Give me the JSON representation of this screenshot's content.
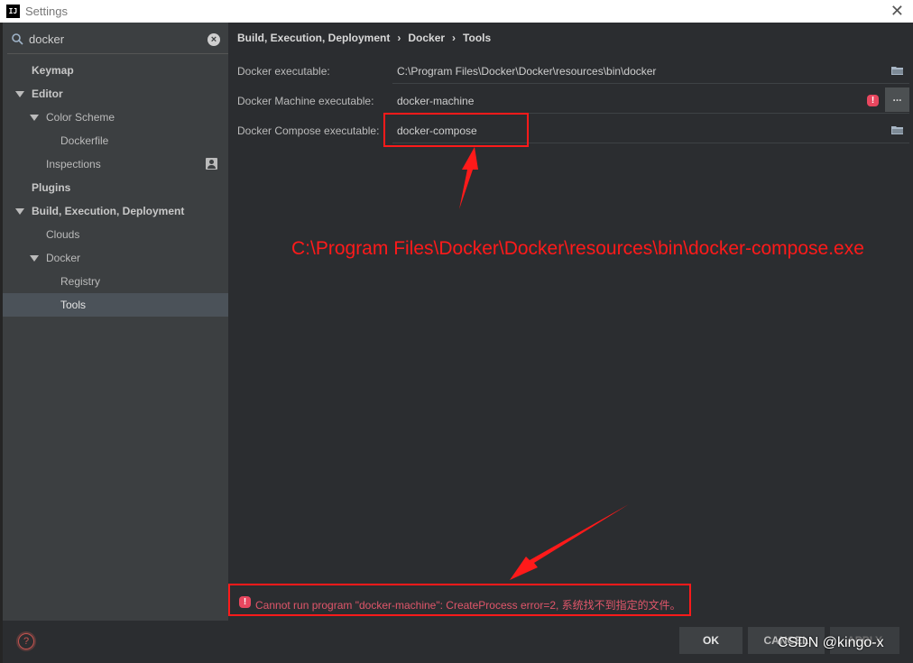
{
  "window": {
    "title": "Settings",
    "app_icon_text": "IJ"
  },
  "search": {
    "value": "docker",
    "placeholder": ""
  },
  "tree": [
    {
      "label": "Keymap"
    },
    {
      "label": "Editor"
    },
    {
      "label": "Color Scheme"
    },
    {
      "label": "Dockerfile"
    },
    {
      "label": "Inspections"
    },
    {
      "label": "Plugins"
    },
    {
      "label": "Build, Execution, Deployment"
    },
    {
      "label": "Clouds"
    },
    {
      "label": "Docker"
    },
    {
      "label": "Registry"
    },
    {
      "label": "Tools"
    }
  ],
  "breadcrumb": [
    "Build, Execution, Deployment",
    "Docker",
    "Tools"
  ],
  "breadcrumb_separator": "›",
  "fields": [
    {
      "label": "Docker executable:",
      "value": "C:\\Program Files\\Docker\\Docker\\resources\\bin\\docker"
    },
    {
      "label": "Docker Machine executable:",
      "value": "docker-machine",
      "browse_label": "..."
    },
    {
      "label": "Docker Compose executable:",
      "value": "docker-compose"
    }
  ],
  "annotation": {
    "text": "C:\\Program Files\\Docker\\Docker\\resources\\bin\\docker-compose.exe",
    "color": "#ff1a1a"
  },
  "error": {
    "icon_text": "!",
    "message": "Cannot run program \"docker-machine\": CreateProcess error=2, 系统找不到指定的文件。"
  },
  "buttons": {
    "ok": "OK",
    "cancel": "CANCEL",
    "apply": "APPLY"
  },
  "help_label": "?",
  "watermark": "CSDN @kingo-x",
  "colors": {
    "background": "#2b2d30",
    "sidebar": "#3c3f41",
    "selected": "#4b5259",
    "error": "#e8475f",
    "annotation": "#ff1a1a"
  }
}
